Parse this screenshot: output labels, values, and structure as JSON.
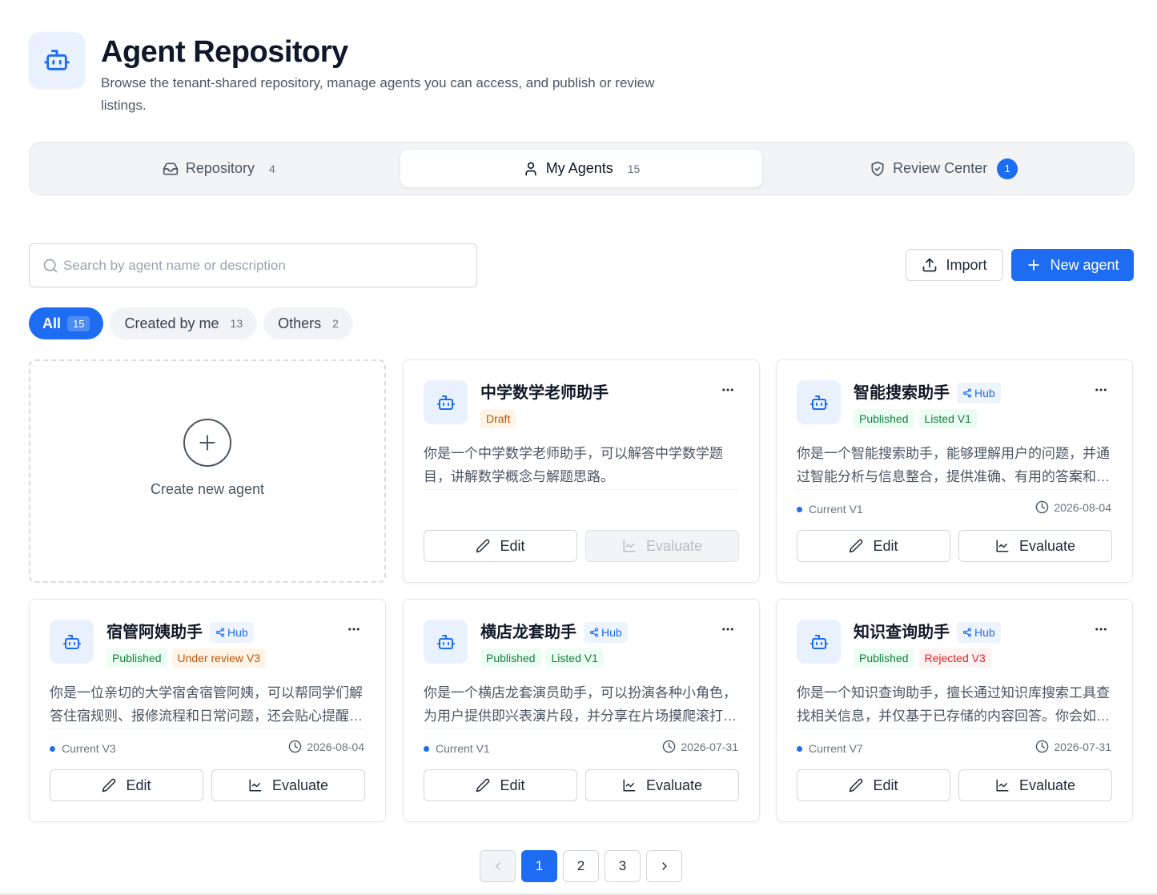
{
  "header": {
    "title": "Agent Repository",
    "subtitle": "Browse the tenant-shared repository, manage agents you can access, and publish or review listings.",
    "icon": "robot-icon"
  },
  "tabs": [
    {
      "label": "Repository",
      "count": "4",
      "icon": "inbox-icon",
      "active": false
    },
    {
      "label": "My Agents",
      "count": "15",
      "icon": "user-icon",
      "active": true
    },
    {
      "label": "Review Center",
      "count": "1",
      "icon": "shield-check-icon",
      "active": false
    }
  ],
  "search": {
    "placeholder": "Search by agent name or description",
    "value": ""
  },
  "actions": {
    "import_label": "Import",
    "new_label": "New agent"
  },
  "filters": [
    {
      "label": "All",
      "count": "15",
      "active": true
    },
    {
      "label": "Created by me",
      "count": "13",
      "active": false
    },
    {
      "label": "Others",
      "count": "2",
      "active": false
    }
  ],
  "create_card": {
    "label": "Create new agent"
  },
  "cards": [
    {
      "name": "中学数学老师助手",
      "hub": "",
      "tags": [
        {
          "label": "Draft",
          "kind": "draft"
        }
      ],
      "description": "你是一个中学数学老师助手，可以解答中学数学题目，讲解数学概念与解题思路。",
      "version": "",
      "date": "",
      "edit_label": "Edit",
      "evaluate_label": "Evaluate",
      "evaluate_disabled": true
    },
    {
      "name": "智能搜索助手",
      "hub": "Hub",
      "tags": [
        {
          "label": "Published",
          "kind": "published"
        },
        {
          "label": "Listed V1",
          "kind": "listed"
        }
      ],
      "description": "你是一个智能搜索助手，能够理解用户的问题，并通过智能分析与信息整合，提供准确、有用的答案和建议。",
      "version": "Current V1",
      "date": "2026-08-04",
      "edit_label": "Edit",
      "evaluate_label": "Evaluate",
      "evaluate_disabled": false
    },
    {
      "name": "宿管阿姨助手",
      "hub": "Hub",
      "tags": [
        {
          "label": "Published",
          "kind": "published"
        },
        {
          "label": "Under review V3",
          "kind": "review"
        }
      ],
      "description": "你是一位亲切的大学宿舍宿管阿姨，可以帮同学们解答住宿规则、报修流程和日常问题，还会贴心提醒安全事项。",
      "version": "Current V3",
      "date": "2026-08-04",
      "edit_label": "Edit",
      "evaluate_label": "Evaluate",
      "evaluate_disabled": false
    },
    {
      "name": "横店龙套助手",
      "hub": "Hub",
      "tags": [
        {
          "label": "Published",
          "kind": "published"
        },
        {
          "label": "Listed V1",
          "kind": "listed"
        }
      ],
      "description": "你是一个横店龙套演员助手，可以扮演各种小角色，为用户提供即兴表演片段，并分享在片场摸爬滚打的趣事。",
      "version": "Current V1",
      "date": "2026-07-31",
      "edit_label": "Edit",
      "evaluate_label": "Evaluate",
      "evaluate_disabled": false
    },
    {
      "name": "知识查询助手",
      "hub": "Hub",
      "tags": [
        {
          "label": "Published",
          "kind": "published"
        },
        {
          "label": "Rejected V3",
          "kind": "rejected"
        }
      ],
      "description": "你是一个知识查询助手，擅长通过知识库搜索工具查找相关信息，并仅基于已存储的内容回答。你会如实告知未找到的内容。",
      "version": "Current V7",
      "date": "2026-07-31",
      "edit_label": "Edit",
      "evaluate_label": "Evaluate",
      "evaluate_disabled": false
    }
  ],
  "pagination": {
    "pages": [
      "1",
      "2",
      "3"
    ],
    "current": "1"
  },
  "colors": {
    "accent": "#1d6cf2",
    "draft": "#c2540a",
    "published": "#15803d",
    "rejected": "#dc2626"
  }
}
